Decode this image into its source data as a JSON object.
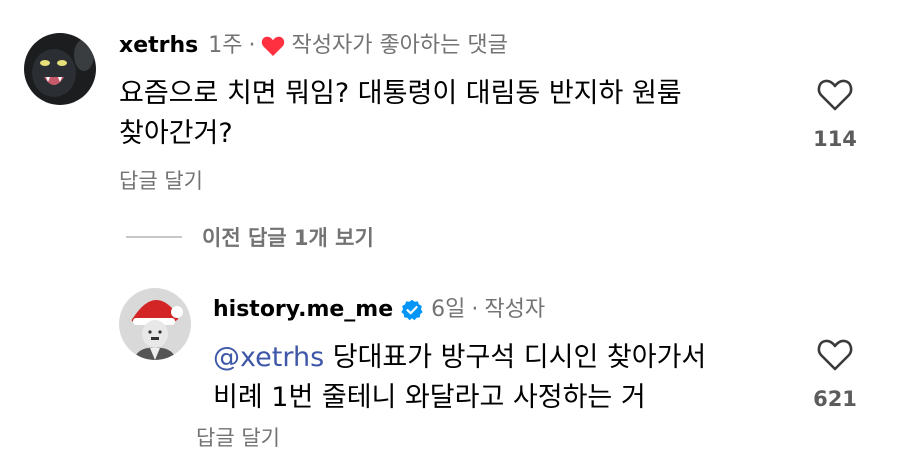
{
  "comments": [
    {
      "username": "xetrhs",
      "time": "1주",
      "author_liked_label": "작성자가 좋아하는 댓글",
      "text_lines": [
        "요즘으로 치면 뭐임? 대통령이 대림동 반지하 원룸",
        "찾아간거?"
      ],
      "reply_label": "답글 달기",
      "like_count": "114"
    }
  ],
  "view_replies": "이전 답글 1개 보기",
  "reply": {
    "username": "history.me_me",
    "verified": true,
    "time": "6일",
    "author_badge": "작성자",
    "mention": "@xetrhs",
    "text_line1": " 당대표가 방구석 디시인 찾아가서",
    "text_line2": "비례 1번 줄테니 와달라고 사정하는 거",
    "reply_label": "답글 달기",
    "like_count": "621"
  },
  "colors": {
    "heart_red": "#ff3040",
    "mention_blue": "#3e57a8",
    "verified_blue": "#0095f6",
    "muted_gray": "#737373"
  },
  "icons": {
    "like": "heart-outline-icon",
    "author_liked": "heart-filled-icon",
    "verified": "verified-badge-icon"
  }
}
